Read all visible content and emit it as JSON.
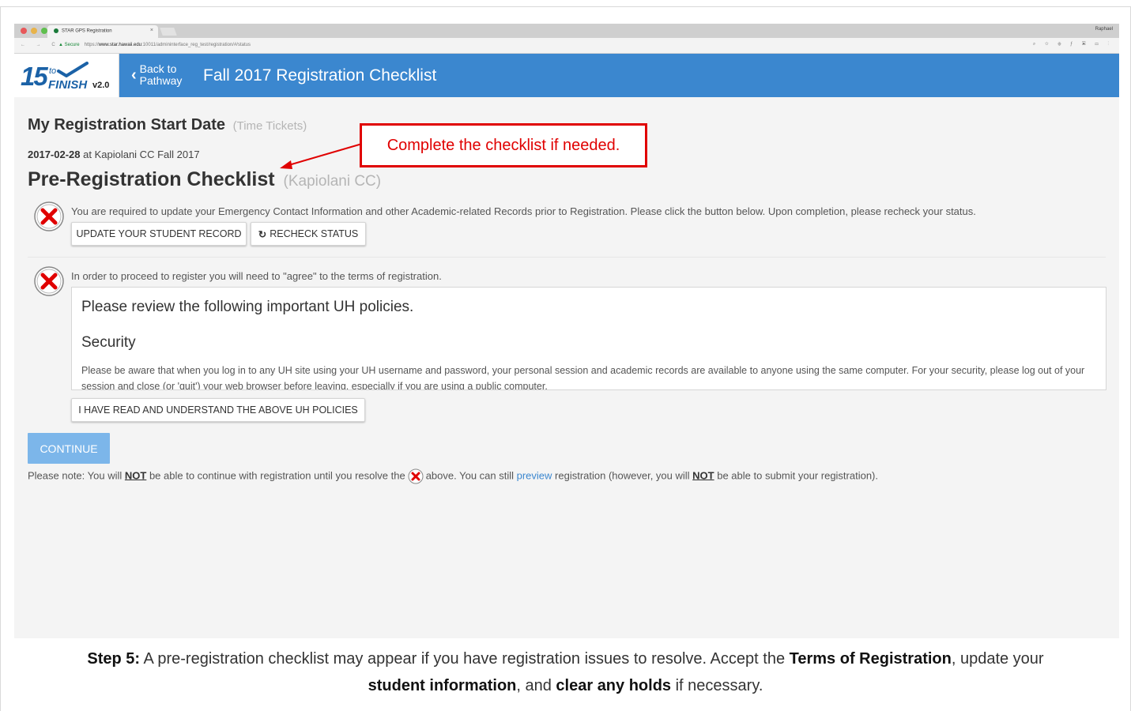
{
  "browser": {
    "tab_title": "STAR GPS Registration",
    "tab_close": "×",
    "user": "Raphael",
    "secure_label": "Secure",
    "url_prefix": "https://",
    "url_host": "www.star.hawaii.edu",
    "url_path": ":10011/admininterface_reg_test/registration/#/status",
    "nav_glyphs": "← → C",
    "ext_glyphs": "⌕ ☆ ⊕ ƒ ▣ ▭ ⋮"
  },
  "header": {
    "logo_number": "15",
    "logo_to": "to",
    "logo_finish": "FINISH",
    "logo_version": "v2.0",
    "back_line1": "Back to",
    "back_line2": "Pathway",
    "back_chevron": "‹",
    "title": "Fall 2017 Registration Checklist"
  },
  "start_date": {
    "heading": "My Registration Start Date",
    "heading_note": "(Time Tickets)",
    "date": "2017-02-28",
    "at_text": "at Kapiolani CC Fall 2017"
  },
  "callout": "Complete the checklist if needed.",
  "checklist": {
    "heading": "Pre-Registration Checklist",
    "heading_note": "(Kapiolani CC)",
    "item1": {
      "message": "You are required to update your Emergency Contact Information and other Academic-related Records prior to Registration. Please click the button below. Upon completion, please recheck your status.",
      "update_button": "UPDATE YOUR STUDENT RECORD",
      "recheck_button": "RECHECK STATUS",
      "recheck_icon": "↻"
    },
    "item2": {
      "message": "In order to proceed to register you will need to \"agree\" to the terms of registration.",
      "policy_heading": "Please review the following important UH policies.",
      "policy_section": "Security",
      "policy_text": "Please be aware that when you log in to any UH site using your UH username and password, your personal session and academic records are available to anyone using the same computer. For your security, please log out of your session and close (or 'quit') your web browser before leaving, especially if you are using a public computer.",
      "agree_button": "I HAVE READ AND UNDERSTAND THE ABOVE UH POLICIES"
    }
  },
  "continue_button": "CONTINUE",
  "note": {
    "t1": "Please note: You will ",
    "not1": "NOT",
    "t2": " be able to continue with registration until you resolve the",
    "t3": "above. You can still ",
    "preview_link": "preview",
    "t4": " registration (however, you will ",
    "not2": "NOT",
    "t5": " be able to submit your registration)."
  },
  "caption": {
    "step_label": "Step 5:",
    "t1": " A pre-registration checklist may appear if you have registration issues to resolve. Accept the  ",
    "terms": "Terms of Registration",
    "t2": ", update your",
    "student_info": "student information",
    "t3": ", and ",
    "clear_holds": "clear any holds",
    "t4": " if necessary."
  },
  "colors": {
    "header_blue": "#3b87cf",
    "error_red": "#e00000",
    "continue_disabled": "#7cb6ea"
  },
  "icons": [
    "error-x-icon",
    "refresh-icon",
    "chevron-left-icon",
    "lock-icon"
  ]
}
